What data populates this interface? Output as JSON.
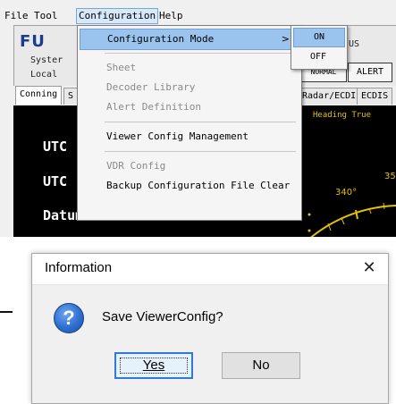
{
  "menubar": {
    "items": [
      "File",
      "Tool",
      "Configuration",
      "Help"
    ],
    "active_index": 2
  },
  "app": {
    "logo_text": "FU",
    "system_label": "Syster",
    "local_label": "Local",
    "status_partial": "US",
    "normal_label": "NORMAL",
    "alert_label": "ALERT",
    "tabs_left": [
      "Conning",
      "S"
    ],
    "tabs_right": [
      "Radar/ECDIS",
      "ECDIS"
    ],
    "rows": [
      "UTC",
      "UTC",
      "Datum"
    ],
    "heading_label": "Heading True",
    "deg_340": "340°",
    "deg_35": "35"
  },
  "config_menu": {
    "items": [
      {
        "label": "Configuration Mode",
        "enabled": true,
        "highlighted": true,
        "has_submenu": true
      },
      {
        "label": "Sheet",
        "enabled": false
      },
      {
        "label": "Decoder Library",
        "enabled": false
      },
      {
        "label": "Alert Definition",
        "enabled": false
      },
      {
        "label": "Viewer Config Management",
        "enabled": true
      },
      {
        "label": "VDR Config",
        "enabled": false
      },
      {
        "label": "Backup Configuration File Clear",
        "enabled": true
      }
    ],
    "submenu_arrow": ">"
  },
  "mode_submenu": {
    "items": [
      "ON",
      "OFF"
    ],
    "highlighted_index": 0
  },
  "dialog": {
    "title": "Information",
    "message": "Save ViewerConfig?",
    "icon": "question-icon",
    "close_glyph": "✕",
    "yes_label": "Yes",
    "no_label": "No"
  },
  "colors": {
    "menu_highlight": "#9ac4ee",
    "default_button_border": "#2f7ad8",
    "heading_text": "#e4c200"
  }
}
